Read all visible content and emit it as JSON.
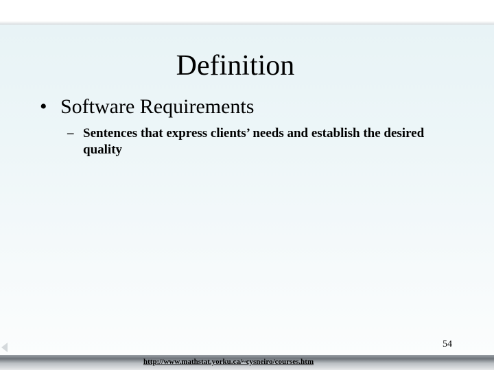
{
  "slide": {
    "title": "Definition",
    "bullet": {
      "mark": "•",
      "text": "Software Requirements"
    },
    "sub_bullet": {
      "mark": "–",
      "text": "Sentences that express clients’ needs and establish the desired quality"
    },
    "page_number": "54"
  },
  "footer": {
    "url": "http://www.mathstat.yorku.ca/~cysneiro/courses.htm"
  }
}
